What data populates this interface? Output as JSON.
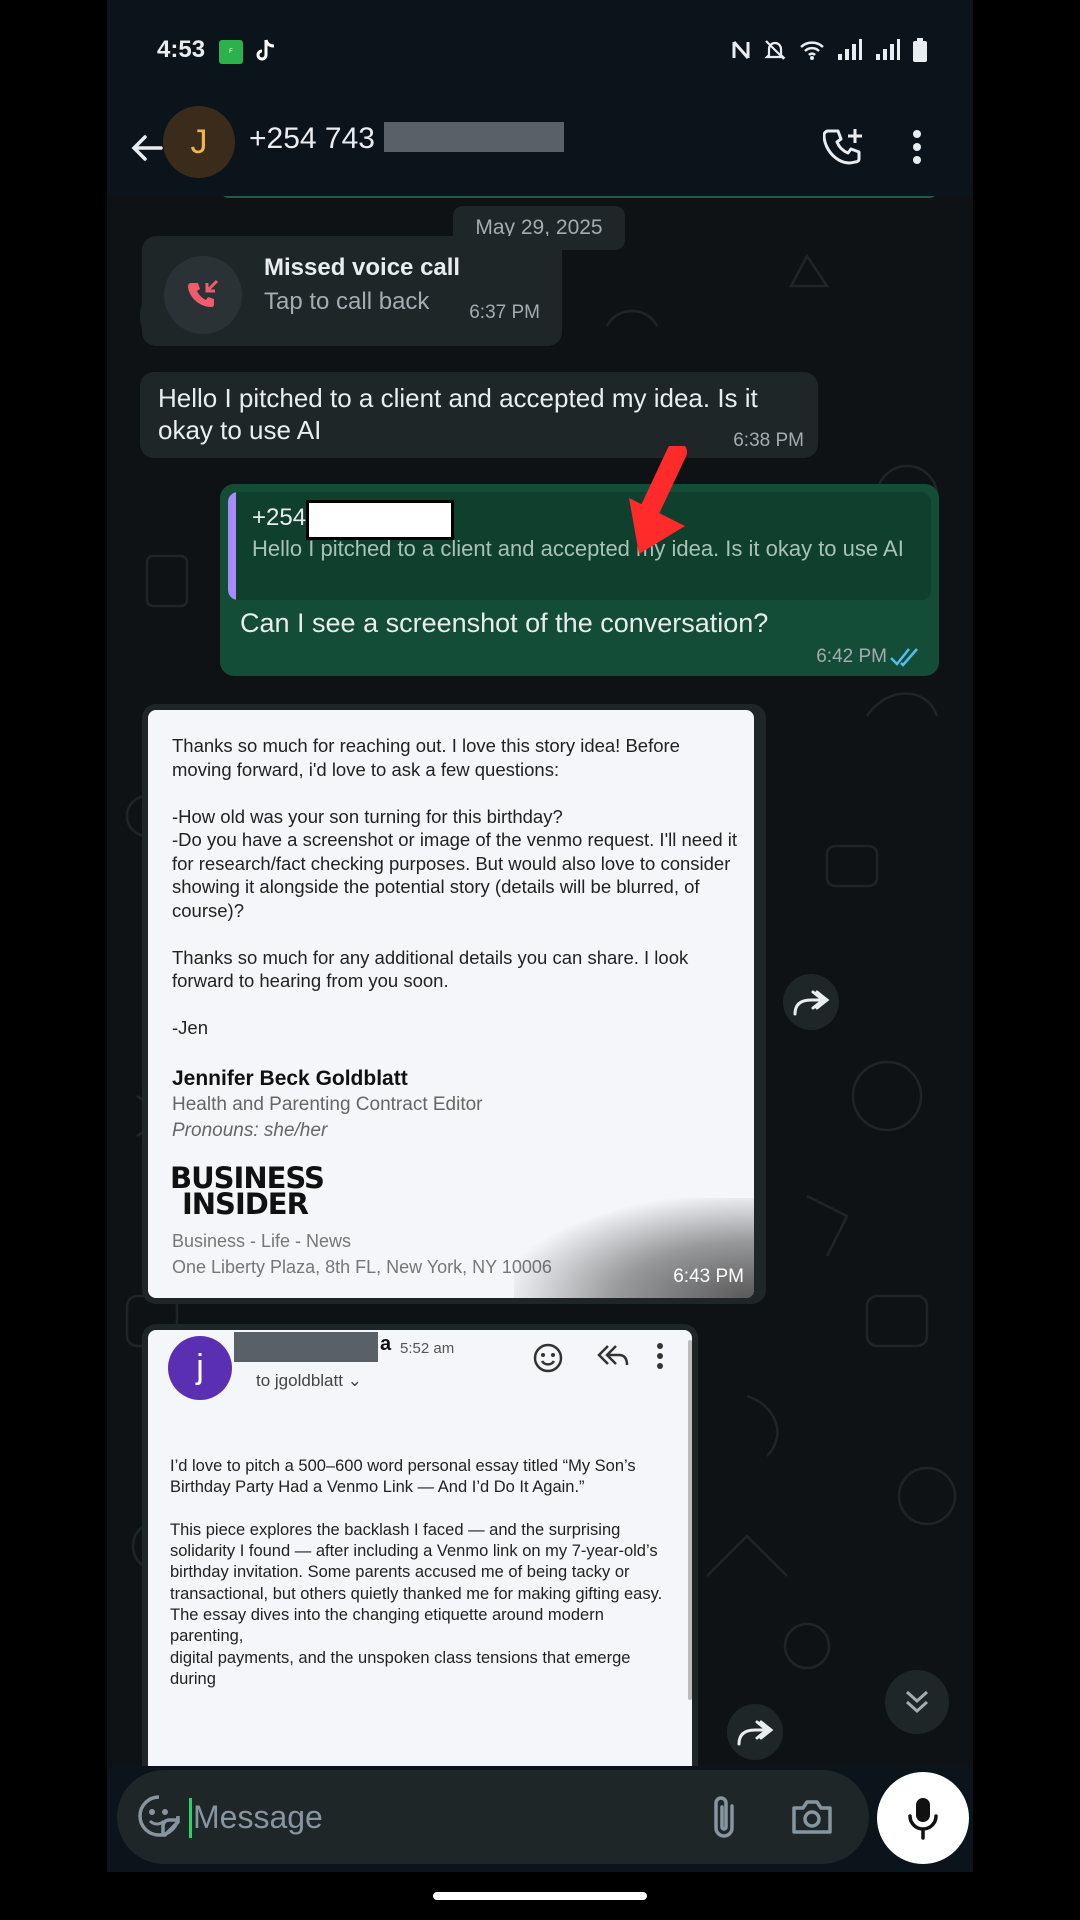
{
  "status_bar": {
    "time": "4:53",
    "icons": [
      "forbes-app-icon",
      "tiktok-icon",
      "nfc-icon",
      "mute-icon",
      "wifi-icon",
      "signal-icon",
      "signal-icon",
      "battery-icon"
    ]
  },
  "header": {
    "avatar_letter": "J",
    "contact_number": "+254 743",
    "accent_color": "#f0b64a"
  },
  "chat": {
    "date_divider": "May 29, 2025",
    "missed_call": {
      "title": "Missed voice call",
      "subtitle": "Tap to call back",
      "time": "6:37 PM"
    },
    "incoming_message": {
      "text": "Hello I pitched to a client and accepted my idea. Is it okay to use AI",
      "time": "6:38 PM"
    },
    "outgoing_message": {
      "quoted_name": "+254",
      "quoted_text": "Hello I pitched to a client and accepted my idea. Is it okay to use AI",
      "text": "Can I see a screenshot of the conversation?",
      "time": "6:42 PM",
      "status": "read"
    },
    "image_message_1": {
      "email_body": "Thanks so much for reaching out. I love this story idea! Before moving forward, i'd love to ask a few questions:\n\n-How old was your son turning for this birthday?\n-Do you have a screenshot or image of the venmo request. I'll need it for research/fact checking purposes. But would also love to consider showing it alongside the potential story (details will be blurred, of course)?\n\nThanks so much for any additional details you can share. I look forward to hearing from you soon.\n\n-Jen",
      "signature_name": "Jennifer Beck Goldblatt",
      "signature_title": "Health and Parenting Contract Editor",
      "signature_pronouns": "Pronouns: she/her",
      "logo_line1": "BUSINESS",
      "logo_line2": "INSIDER",
      "tags": "Business - Life - News",
      "address": "One Liberty Plaza, 8th FL, New York, NY 10006",
      "time": "6:43 PM"
    },
    "image_message_2": {
      "avatar_letter": "j",
      "sender_suffix": "a",
      "sent_time": "5:52 am",
      "to_line": "to jgoldblatt",
      "essay_text": "I’d love to pitch a 500–600 word personal essay titled “My Son’s\nBirthday Party Had a Venmo Link — And I’d Do It Again.”\n\nThis piece explores the backlash I faced — and the surprising solidarity I found — after including a Venmo link on my 7-year-old’s\nbirthday invitation. Some parents accused me of being tacky or\ntransactional, but others quietly thanked me for making gifting easy.\nThe essay dives into the changing etiquette around modern parenting,\ndigital payments, and the unspoken class tensions that emerge during"
    }
  },
  "composer": {
    "placeholder": "Message"
  },
  "colors": {
    "background": "#0b141a",
    "incoming_bubble": "#1f2628",
    "outgoing_bubble": "#144d37",
    "read_ticks": "#53bdeb",
    "missed_call_red": "#f15c6d",
    "annotation_arrow": "#ff2a2a"
  }
}
